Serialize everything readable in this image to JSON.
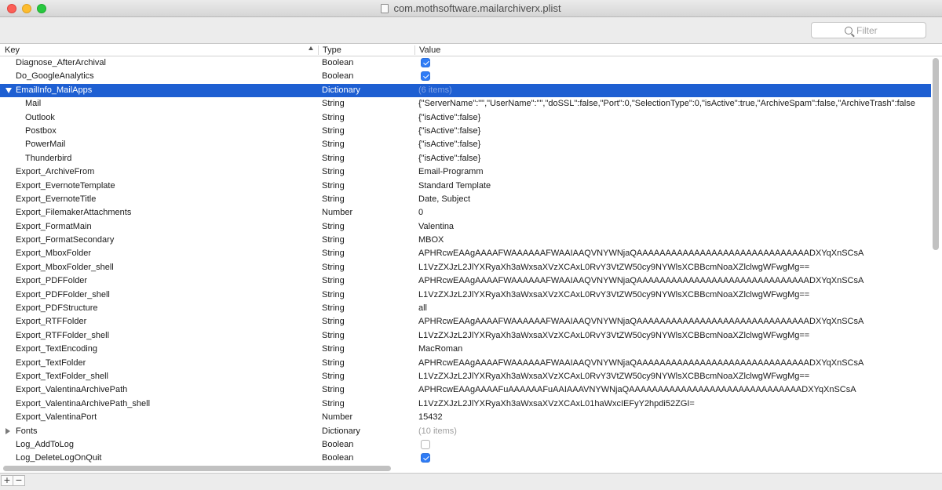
{
  "window": {
    "title": "com.mothsoftware.mailarchiverx.plist"
  },
  "toolbar": {
    "filter_placeholder": "Filter"
  },
  "columns": {
    "key": "Key",
    "type": "Type",
    "value": "Value"
  },
  "rows": [
    {
      "key": "Diagnose_AfterArchival",
      "type": "Boolean",
      "kind": "check",
      "checked": true
    },
    {
      "key": "Do_GoogleAnalytics",
      "type": "Boolean",
      "kind": "check",
      "checked": true
    },
    {
      "key": "EmailInfo_MailApps",
      "type": "Dictionary",
      "value": "(6 items)",
      "kind": "count",
      "disclosure": "open",
      "selected": true
    },
    {
      "key": "Mail",
      "type": "String",
      "value": "{\"ServerName\":\"\",\"UserName\":\"\",\"doSSL\":false,\"Port\":0,\"SelectionType\":0,\"isActive\":true,\"ArchiveSpam\":false,\"ArchiveTrash\":false",
      "child": true
    },
    {
      "key": "Outlook",
      "type": "String",
      "value": "{\"isActive\":false}",
      "child": true
    },
    {
      "key": "Postbox",
      "type": "String",
      "value": "{\"isActive\":false}",
      "child": true
    },
    {
      "key": "PowerMail",
      "type": "String",
      "value": "{\"isActive\":false}",
      "child": true
    },
    {
      "key": "Thunderbird",
      "type": "String",
      "value": "{\"isActive\":false}",
      "child": true
    },
    {
      "key": "Export_ArchiveFrom",
      "type": "String",
      "value": "Email-Programm"
    },
    {
      "key": "Export_EvernoteTemplate",
      "type": "String",
      "value": "Standard Template"
    },
    {
      "key": "Export_EvernoteTitle",
      "type": "String",
      "value": "Date, Subject"
    },
    {
      "key": "Export_FilemakerAttachments",
      "type": "Number",
      "value": "0"
    },
    {
      "key": "Export_FormatMain",
      "type": "String",
      "value": "Valentina"
    },
    {
      "key": "Export_FormatSecondary",
      "type": "String",
      "value": "MBOX"
    },
    {
      "key": "Export_MboxFolder",
      "type": "String",
      "value": "APHRcwEAAgAAAAFWAAAAAAFWAAIAAQVNYWNjaQAAAAAAAAAAAAAAAAAAAAAAAAAAAAAADXYqXnSCsA"
    },
    {
      "key": "Export_MboxFolder_shell",
      "type": "String",
      "value": "L1VzZXJzL2JlYXRyaXh3aWxsaXVzXCAxL0RvY3VtZW50cy9NYWlsXCBBcmNoaXZlclwgWFwgMg=="
    },
    {
      "key": "Export_PDFFolder",
      "type": "String",
      "value": "APHRcwEAAgAAAAFWAAAAAAFWAAIAAQVNYWNjaQAAAAAAAAAAAAAAAAAAAAAAAAAAAAAADXYqXnSCsA"
    },
    {
      "key": "Export_PDFFolder_shell",
      "type": "String",
      "value": "L1VzZXJzL2JlYXRyaXh3aWxsaXVzXCAxL0RvY3VtZW50cy9NYWlsXCBBcmNoaXZlclwgWFwgMg=="
    },
    {
      "key": "Export_PDFStructure",
      "type": "String",
      "value": "all"
    },
    {
      "key": "Export_RTFFolder",
      "type": "String",
      "value": "APHRcwEAAgAAAAFWAAAAAAFWAAIAAQVNYWNjaQAAAAAAAAAAAAAAAAAAAAAAAAAAAAAADXYqXnSCsA"
    },
    {
      "key": "Export_RTFFolder_shell",
      "type": "String",
      "value": "L1VzZXJzL2JlYXRyaXh3aWxsaXVzXCAxL0RvY3VtZW50cy9NYWlsXCBBcmNoaXZlclwgWFwgMg=="
    },
    {
      "key": "Export_TextEncoding",
      "type": "String",
      "value": "MacRoman"
    },
    {
      "key": "Export_TextFolder",
      "type": "String",
      "value": "APHRcwEAAgAAAAFWAAAAAAFWAAIAAQVNYWNjaQAAAAAAAAAAAAAAAAAAAAAAAAAAAAAADXYqXnSCsA"
    },
    {
      "key": "Export_TextFolder_shell",
      "type": "String",
      "value": "L1VzZXJzL2JlYXRyaXh3aWxsaXVzXCAxL0RvY3VtZW50cy9NYWlsXCBBcmNoaXZlclwgWFwgMg=="
    },
    {
      "key": "Export_ValentinaArchivePath",
      "type": "String",
      "value": "APHRcwEAAgAAAAFuAAAAAAFuAAIAAAVNYWNjaQAAAAAAAAAAAAAAAAAAAAAAAAAAAAAADXYqXnSCsA"
    },
    {
      "key": "Export_ValentinaArchivePath_shell",
      "type": "String",
      "value": "L1VzZXJzL2JlYXRyaXh3aWxsaXVzXCAxL01haWxcIEFyY2hpdi52ZGI="
    },
    {
      "key": "Export_ValentinaPort",
      "type": "Number",
      "value": "15432"
    },
    {
      "key": "Fonts",
      "type": "Dictionary",
      "value": "(10 items)",
      "kind": "count",
      "disclosure": "closed"
    },
    {
      "key": "Log_AddToLog",
      "type": "Boolean",
      "kind": "check",
      "checked": false
    },
    {
      "key": "Log_DeleteLogOnQuit",
      "type": "Boolean",
      "kind": "check",
      "checked": true
    }
  ],
  "bottombar": {
    "add_label": "+",
    "remove_label": "−"
  },
  "colors": {
    "selection": "#1e5fd2",
    "checkbox": "#2f7cf6"
  }
}
